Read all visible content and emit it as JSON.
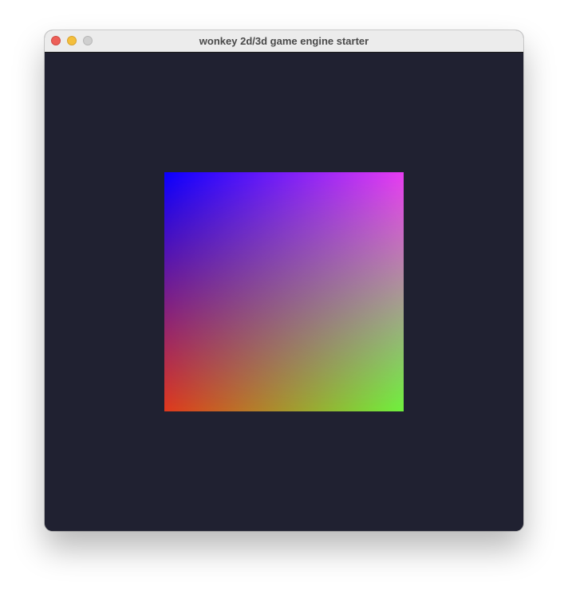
{
  "window": {
    "title": "wonkey 2d/3d game engine starter",
    "background_color": "#202131",
    "titlebar": {
      "close_button": {
        "icon": "close-icon",
        "color": "#ed5f58"
      },
      "minimize_button": {
        "icon": "minimize-icon",
        "color": "#f4bf3c"
      },
      "zoom_button": {
        "icon": "zoom-icon",
        "color": "#cfcfcf"
      }
    }
  },
  "canvas": {
    "shape": "quad",
    "corner_colors": {
      "top_left": "#0a00ff",
      "top_right": "#e83cf2",
      "bottom_left": "#e0381c",
      "bottom_right": "#6ef23c"
    }
  }
}
